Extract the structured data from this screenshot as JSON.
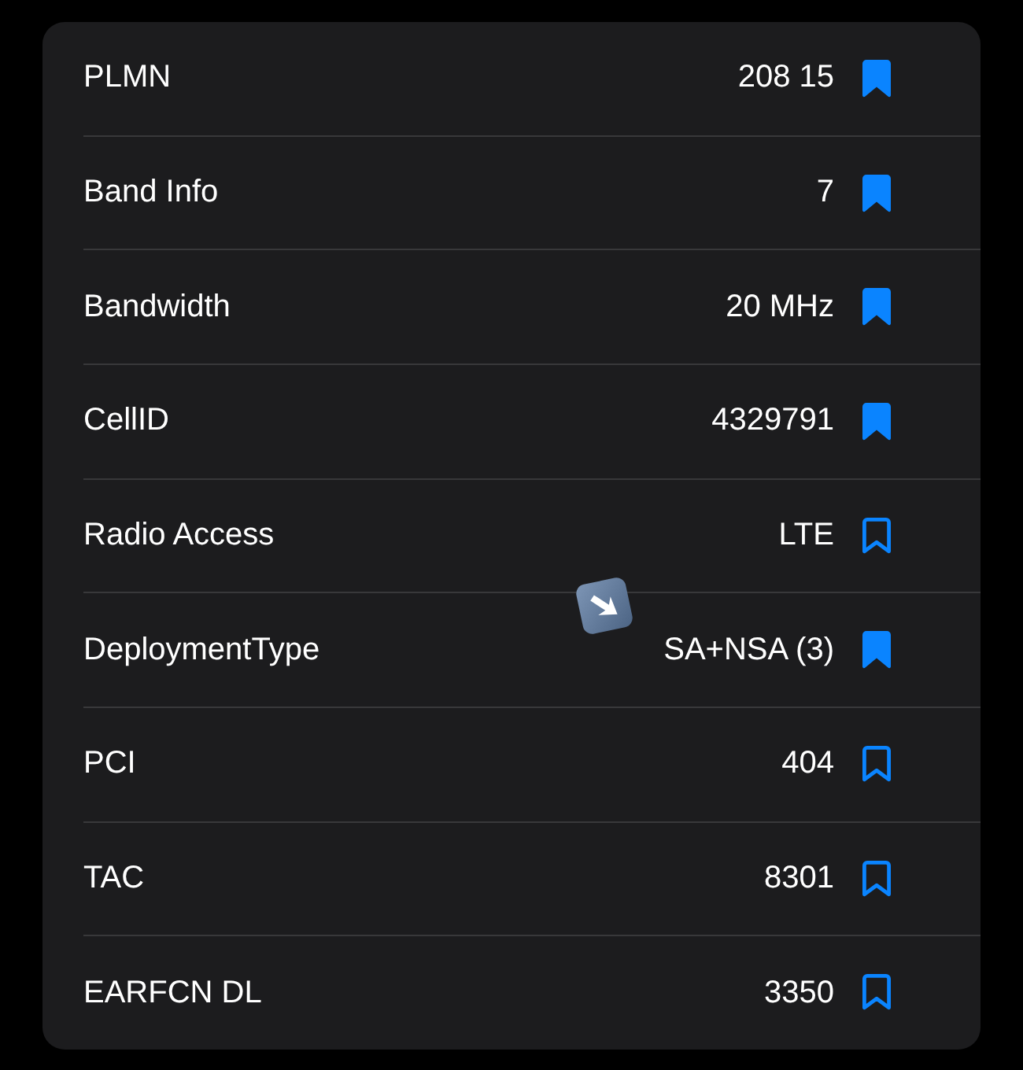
{
  "rows": [
    {
      "label": "PLMN",
      "value": "208 15",
      "bookmarked": true
    },
    {
      "label": "Band Info",
      "value": "7",
      "bookmarked": true
    },
    {
      "label": "Bandwidth",
      "value": "20 MHz",
      "bookmarked": true
    },
    {
      "label": "CellID",
      "value": "4329791",
      "bookmarked": true
    },
    {
      "label": "Radio Access",
      "value": "LTE",
      "bookmarked": false
    },
    {
      "label": "DeploymentType",
      "value": "SA+NSA (3)",
      "bookmarked": true
    },
    {
      "label": "PCI",
      "value": "404",
      "bookmarked": false
    },
    {
      "label": "TAC",
      "value": "8301",
      "bookmarked": false
    },
    {
      "label": "EARFCN DL",
      "value": "3350",
      "bookmarked": false
    }
  ]
}
